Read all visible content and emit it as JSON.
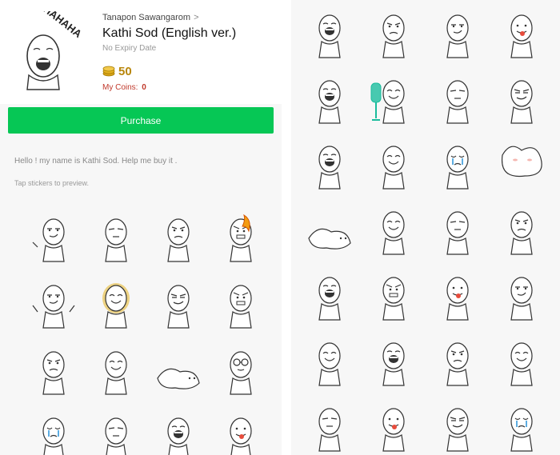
{
  "product": {
    "author": "Tanapon Sawangarom",
    "title": "Kathi Sod (English ver.)",
    "expiry": "No Expiry Date",
    "price": "50",
    "my_coins_label": "My Coins:",
    "my_coins_value": "0",
    "main_sticker_text": "HAHAHA"
  },
  "purchase": {
    "label": "Purchase",
    "color": "#06c755"
  },
  "description": "Hello ! my name is Kathi Sod. Help me buy it .",
  "tap_hint": "Tap stickers to preview.",
  "left_stickers": [
    {
      "name": "pointing",
      "face": "smirk",
      "extra": "point"
    },
    {
      "name": "disgusted",
      "face": "squint",
      "extra": "none"
    },
    {
      "name": "worried",
      "face": "worried",
      "extra": "none"
    },
    {
      "name": "on-fire",
      "face": "angry",
      "extra": "fire"
    },
    {
      "name": "shrug",
      "face": "smirk",
      "extra": "shrug"
    },
    {
      "name": "golden",
      "face": "happy",
      "extra": "gold"
    },
    {
      "name": "scheming",
      "face": "scheme",
      "extra": "none"
    },
    {
      "name": "mumbling",
      "face": "angry",
      "extra": "none"
    },
    {
      "name": "annoyed",
      "face": "worried",
      "extra": "none"
    },
    {
      "name": "dancing",
      "face": "happy",
      "extra": "none"
    },
    {
      "name": "lying-down",
      "face": "sleep",
      "extra": "lying"
    },
    {
      "name": "glasses",
      "face": "glasses",
      "extra": "none"
    },
    {
      "name": "crying",
      "face": "cry",
      "extra": "none"
    },
    {
      "name": "confused",
      "face": "squint",
      "extra": "none"
    },
    {
      "name": "laughing",
      "face": "laugh",
      "extra": "none"
    },
    {
      "name": "tongue",
      "face": "tongue",
      "extra": "none"
    }
  ],
  "right_stickers": [
    {
      "name": "laughing",
      "face": "laugh",
      "extra": "none"
    },
    {
      "name": "sad",
      "face": "worried",
      "extra": "none"
    },
    {
      "name": "smirking",
      "face": "smirk",
      "extra": "none"
    },
    {
      "name": "tongue",
      "face": "tongue",
      "extra": "none"
    },
    {
      "name": "grinning",
      "face": "laugh",
      "extra": "none"
    },
    {
      "name": "fan",
      "face": "happy",
      "extra": "fan"
    },
    {
      "name": "hair",
      "face": "squint",
      "extra": "none"
    },
    {
      "name": "ohmg",
      "face": "scheme",
      "extra": "none"
    },
    {
      "name": "shocked",
      "face": "laugh",
      "extra": "none"
    },
    {
      "name": "waving",
      "face": "happy",
      "extra": "none"
    },
    {
      "name": "blue-tears",
      "face": "cry",
      "extra": "none"
    },
    {
      "name": "blob",
      "face": "sleep",
      "extra": "blob"
    },
    {
      "name": "flat",
      "face": "sleep",
      "extra": "lying"
    },
    {
      "name": "cheering",
      "face": "happy",
      "extra": "none"
    },
    {
      "name": "pondering",
      "face": "squint",
      "extra": "none"
    },
    {
      "name": "nod",
      "face": "worried",
      "extra": "none"
    },
    {
      "name": "hahaha",
      "face": "laugh",
      "extra": "none"
    },
    {
      "name": "teeth",
      "face": "angry",
      "extra": "none"
    },
    {
      "name": "lips",
      "face": "tongue",
      "extra": "none"
    },
    {
      "name": "pointing",
      "face": "smirk",
      "extra": "none"
    },
    {
      "name": "sparkle",
      "face": "happy",
      "extra": "none"
    },
    {
      "name": "red-hearts",
      "face": "laugh",
      "extra": "none"
    },
    {
      "name": "blank",
      "face": "worried",
      "extra": "none"
    },
    {
      "name": "shy",
      "face": "happy",
      "extra": "none"
    },
    {
      "name": "dazed",
      "face": "squint",
      "extra": "none"
    },
    {
      "name": "kissing",
      "face": "tongue",
      "extra": "none"
    },
    {
      "name": "stripes",
      "face": "scheme",
      "extra": "none"
    },
    {
      "name": "blue-cry",
      "face": "cry",
      "extra": "none"
    }
  ]
}
